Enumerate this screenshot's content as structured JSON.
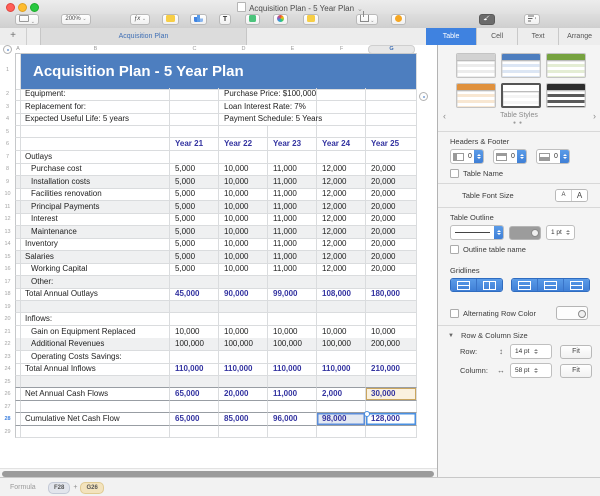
{
  "window": {
    "title": "Acquisition Plan - 5 Year Plan"
  },
  "toolbar": {
    "view": {
      "label": "View"
    },
    "zoom": {
      "label": "Zoom",
      "value": "200%"
    },
    "center": [
      "Formula",
      "Table",
      "Chart",
      "Text",
      "Shape",
      "Media",
      "Comment"
    ],
    "share": {
      "label": "Share"
    },
    "tips": {
      "label": "Tips"
    },
    "format": {
      "label": "Format"
    },
    "sort_filter": {
      "label": "Sort & Filter"
    }
  },
  "sheet_tabs": {
    "add": "+",
    "active": "Acquisition Plan"
  },
  "inspector": {
    "tabs": [
      "Table",
      "Cell",
      "Text",
      "Arrange"
    ],
    "active_tab": "Table",
    "styles": {
      "label": "Table Styles",
      "thumbs": [
        {
          "name": "plain-gray",
          "header": "#d2d2d2",
          "row": "#ececec",
          "selected": false
        },
        {
          "name": "blue",
          "header": "#4d7ebf",
          "row": "#dce6f4",
          "selected": false
        },
        {
          "name": "green",
          "header": "#76a23f",
          "row": "#e4edd4",
          "selected": false
        },
        {
          "name": "orange",
          "header": "#e0913d",
          "row": "#f8e7d2",
          "selected": false
        },
        {
          "name": "white-outline",
          "header": "#ffffff",
          "row": "#f4f4f4",
          "selected": true
        },
        {
          "name": "dark",
          "header": "#2d2d2d",
          "row": "#5a5a5a",
          "selected": false
        }
      ]
    },
    "headers_footer": {
      "label": "Headers & Footer",
      "steppers": [
        {
          "name": "header-columns",
          "value": "0"
        },
        {
          "name": "header-rows",
          "value": "0"
        },
        {
          "name": "footer-rows",
          "value": "0"
        }
      ],
      "table_name": "Table Name"
    },
    "font_size": {
      "label": "Table Font Size",
      "small": "A",
      "big": "A"
    },
    "outline": {
      "label": "Table Outline",
      "width": "1 pt",
      "checkbox": "Outline table name"
    },
    "gridlines": {
      "label": "Gridlines"
    },
    "alt_row": {
      "label": "Alternating Row Color"
    },
    "row_col": {
      "label": "Row & Column Size",
      "row_label": "Row:",
      "row_value": "14 pt",
      "col_label": "Column:",
      "col_value": "58 pt",
      "fit": "Fit"
    }
  },
  "spreadsheet": {
    "columns": [
      "A",
      "B",
      "C",
      "D",
      "E",
      "F",
      "G"
    ],
    "selected_column": "G",
    "title": "Acquisition Plan -  5 Year Plan",
    "info_rows": [
      {
        "n": 2,
        "left": "Equipment:",
        "right": "Purchase Price: $100,000"
      },
      {
        "n": 3,
        "left": "Replacement for:",
        "right": "Loan Interest Rate:  7%"
      },
      {
        "n": 4,
        "left": "Expected Useful Life: 5 years",
        "right": "Payment Schedule: 5 Years"
      }
    ],
    "rows": [
      {
        "n": 5,
        "label": "",
        "values": [
          "",
          "",
          "",
          "",
          ""
        ]
      },
      {
        "n": 6,
        "type": "yearhead",
        "label": "",
        "values": [
          "Year 21",
          "Year 22",
          "Year 23",
          "Year 24",
          "Year 25"
        ]
      },
      {
        "n": 7,
        "label": "Outlays",
        "values": [
          "",
          "",
          "",
          "",
          ""
        ]
      },
      {
        "n": 8,
        "label": "Purchase cost",
        "indent": true,
        "values": [
          "5,000",
          "10,000",
          "11,000",
          "12,000",
          "20,000"
        ]
      },
      {
        "n": 9,
        "label": "Installation costs",
        "indent": true,
        "shaded": true,
        "values": [
          "5,000",
          "10,000",
          "11,000",
          "12,000",
          "20,000"
        ]
      },
      {
        "n": 10,
        "label": "Facilities renovation",
        "indent": true,
        "values": [
          "5,000",
          "10,000",
          "11,000",
          "12,000",
          "20,000"
        ]
      },
      {
        "n": 11,
        "label": "Principal Payments",
        "indent": true,
        "shaded": true,
        "values": [
          "5,000",
          "10,000",
          "11,000",
          "12,000",
          "20,000"
        ]
      },
      {
        "n": 12,
        "label": "Interest",
        "indent": true,
        "values": [
          "5,000",
          "10,000",
          "11,000",
          "12,000",
          "20,000"
        ]
      },
      {
        "n": 13,
        "label": "Maintenance",
        "indent": true,
        "shaded": true,
        "values": [
          "5,000",
          "10,000",
          "11,000",
          "12,000",
          "20,000"
        ]
      },
      {
        "n": 14,
        "label": "Inventory",
        "values": [
          "5,000",
          "10,000",
          "11,000",
          "12,000",
          "20,000"
        ]
      },
      {
        "n": 15,
        "label": "Salaries",
        "shaded": true,
        "values": [
          "5,000",
          "10,000",
          "11,000",
          "12,000",
          "20,000"
        ]
      },
      {
        "n": 16,
        "label": "Working Capital",
        "indent": true,
        "values": [
          "5,000",
          "10,000",
          "11,000",
          "12,000",
          "20,000"
        ]
      },
      {
        "n": 17,
        "label": "Other:",
        "indent": true,
        "shaded": true,
        "values": [
          "",
          "",
          "",
          "",
          ""
        ]
      },
      {
        "n": 18,
        "label": "Total Annual Outlays",
        "total": true,
        "values": [
          "45,000",
          "90,000",
          "99,000",
          "108,000",
          "180,000"
        ]
      },
      {
        "n": 19,
        "label": "",
        "shaded": true,
        "values": [
          "",
          "",
          "",
          "",
          ""
        ]
      },
      {
        "n": 20,
        "label": "Inflows:",
        "values": [
          "",
          "",
          "",
          "",
          ""
        ]
      },
      {
        "n": 21,
        "label": "Gain on Equipment Replaced",
        "indent": true,
        "values": [
          "10,000",
          "10,000",
          "10,000",
          "10,000",
          "10,000"
        ]
      },
      {
        "n": 22,
        "label": "Additional Revenues",
        "indent": true,
        "shaded": true,
        "values": [
          "100,000",
          "100,000",
          "100,000",
          "100,000",
          "200,000"
        ]
      },
      {
        "n": 23,
        "label": "Operating Costs Savings:",
        "indent": true,
        "values": [
          "",
          "",
          "",
          "",
          ""
        ]
      },
      {
        "n": 24,
        "label": "Total Annual Inflows",
        "total": true,
        "values": [
          "110,000",
          "110,000",
          "110,000",
          "110,000",
          "210,000"
        ]
      },
      {
        "n": 25,
        "label": "",
        "shaded": true,
        "strongBottom": true,
        "values": [
          "",
          "",
          "",
          "",
          ""
        ]
      },
      {
        "n": 26,
        "label": "Net Annual Cash Flows",
        "total": true,
        "strongBottom": true,
        "values": [
          "65,000",
          "20,000",
          "11,000",
          "2,000",
          "30,000"
        ],
        "highlights": {
          "4": "orange"
        }
      },
      {
        "n": 27,
        "label": "",
        "strongBottom": true,
        "values": [
          "",
          "",
          "",
          "",
          ""
        ]
      },
      {
        "n": 28,
        "label": "Cumulative Net Cash Flow",
        "total": true,
        "strongBottom": true,
        "gutterActive": true,
        "values": [
          "65,000",
          "85,000",
          "96,000",
          "98,000",
          "128,000"
        ],
        "highlights": {
          "3": "blue",
          "4": "selected"
        }
      },
      {
        "n": 29,
        "label": "",
        "values": [
          "",
          "",
          "",
          "",
          ""
        ]
      }
    ]
  },
  "formula_bar": {
    "label": "Formula",
    "tokens": [
      {
        "text": "F28",
        "style": "blue"
      },
      {
        "text": "+",
        "style": "op"
      },
      {
        "text": "G26",
        "style": "orange"
      }
    ]
  },
  "colors": {
    "title_blue": "#4d7ebf",
    "value_blue": "#3333a0",
    "accent_blue": "#3f82e0",
    "highlight_orange": "#c9a55f",
    "highlight_blue": "#5b8dd9"
  }
}
